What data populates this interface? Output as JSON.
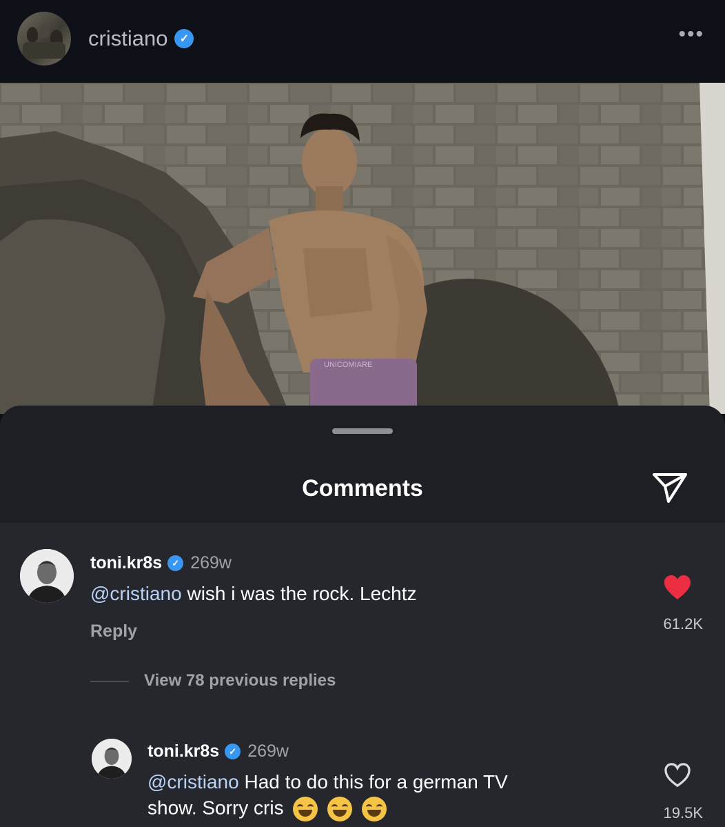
{
  "header": {
    "username": "cristiano",
    "verified_icon": "verified-badge-icon",
    "more_icon": "more-options-icon",
    "more_glyph": "•••"
  },
  "photo": {
    "icon": "post-photo",
    "shorts_text": "UNICOMIARE"
  },
  "sheet": {
    "title": "Comments",
    "share_icon": "send-icon"
  },
  "comments": [
    {
      "username": "toni.kr8s",
      "time": "269w",
      "mention": "@cristiano",
      "text": " wish i was the rock. Lechtz",
      "reply_label": "Reply",
      "like_count": "61.2K",
      "liked": true,
      "heart_color": "#ed2e42"
    }
  ],
  "view_replies": "View 78 previous replies",
  "reply": {
    "username": "toni.kr8s",
    "time": "269w",
    "mention": "@cristiano",
    "text_line1": " Had to do this for a german TV",
    "text_line2": "show. Sorry cris",
    "like_count": "19.5K",
    "liked": false
  },
  "colors": {
    "mention": "#b8d3f7",
    "verified": "#3897f0",
    "sheet": "#25272c"
  }
}
